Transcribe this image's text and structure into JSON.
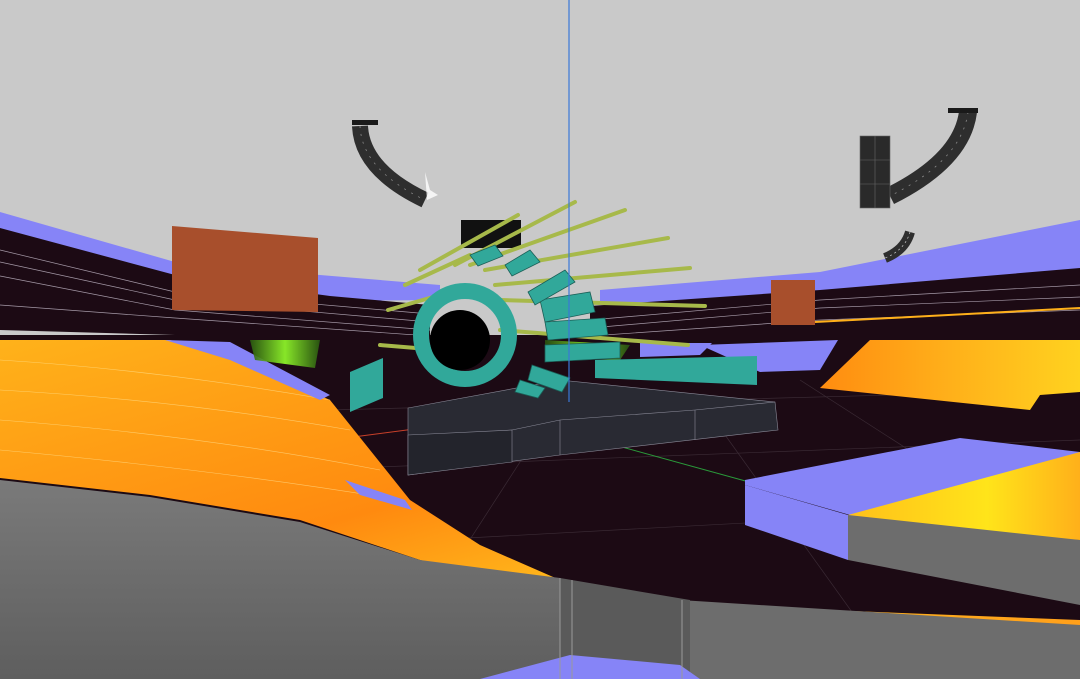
{
  "viewport": {
    "label": "",
    "camera": "perspective",
    "grid_visible": true,
    "axes_visible": true,
    "colors": {
      "sky": "#c9c9c9",
      "floor": "#1c0a14",
      "seating_coverage_hot": "#ff9a1a",
      "seating_coverage_peak": "#ffe11a",
      "seating_coverage_low": "#93ff2a",
      "tier_surface": "#8684f7",
      "video_screen": "#a84f2c",
      "speaker_array": "#2e2e2e",
      "stage_elements": "#31a89a",
      "light_rays": "#a7b94a",
      "stage_deck": "#292a33",
      "lower_bowl": "#6e6e6e",
      "z_axis": "#3a78d8",
      "x_axis": "#c8402a",
      "y_axis": "#2a9a3a"
    }
  },
  "objects": [
    {
      "name": "left-speaker-array",
      "type": "line-array"
    },
    {
      "name": "right-speaker-array",
      "type": "line-array"
    },
    {
      "name": "right-side-fill-array",
      "type": "line-array"
    },
    {
      "name": "right-sub-stack",
      "type": "subwoofer"
    },
    {
      "name": "left-video-screen",
      "type": "screen"
    },
    {
      "name": "right-video-screen",
      "type": "screen"
    },
    {
      "name": "center-stage-ring",
      "type": "stage-prop"
    },
    {
      "name": "stage-deck",
      "type": "stage"
    }
  ]
}
